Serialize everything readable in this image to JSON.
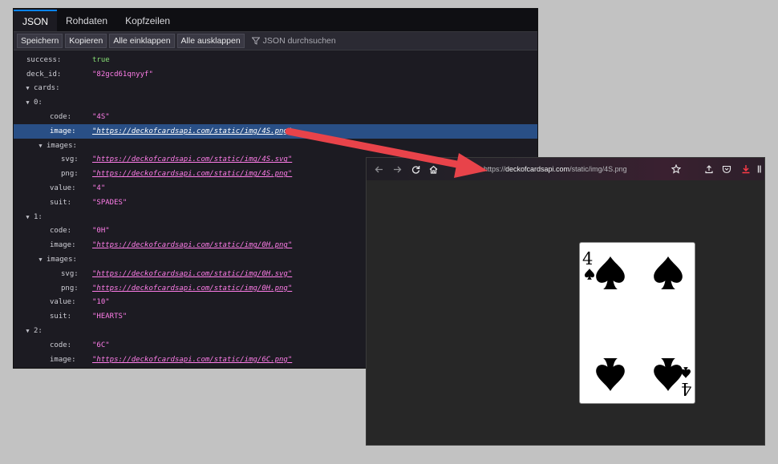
{
  "json_viewer": {
    "tabs": [
      "JSON",
      "Rohdaten",
      "Kopfzeilen"
    ],
    "active_tab": "JSON",
    "toolbar": {
      "save": "Speichern",
      "copy": "Kopieren",
      "collapse_all": "Alle einklappen",
      "expand_all": "Alle ausklappen",
      "filter_placeholder": "JSON durchsuchen"
    },
    "rows": [
      {
        "indent": 0,
        "twisty": "",
        "key": "success:",
        "value": "true",
        "type": "true"
      },
      {
        "indent": 0,
        "twisty": "",
        "key": "deck_id:",
        "value": "\"82gcd61qnyyf\"",
        "type": "str"
      },
      {
        "indent": 0,
        "twisty": "▼",
        "key": "cards:",
        "value": "",
        "type": ""
      },
      {
        "indent": 1,
        "twisty": "▼",
        "key": "0:",
        "value": "",
        "type": ""
      },
      {
        "indent": 3,
        "twisty": "",
        "key": "code:",
        "value": "\"4S\"",
        "type": "str"
      },
      {
        "indent": 3,
        "twisty": "",
        "key": "image:",
        "value": "\"https://deckofcardsapi.com/static/img/4S.png\"",
        "type": "link",
        "selected": true
      },
      {
        "indent": 2,
        "twisty": "▼",
        "key": "images:",
        "value": "",
        "type": ""
      },
      {
        "indent": 4,
        "twisty": "",
        "key": "svg:",
        "value": "\"https://deckofcardsapi.com/static/img/4S.svg\"",
        "type": "link"
      },
      {
        "indent": 4,
        "twisty": "",
        "key": "png:",
        "value": "\"https://deckofcardsapi.com/static/img/4S.png\"",
        "type": "link"
      },
      {
        "indent": 3,
        "twisty": "",
        "key": "value:",
        "value": "\"4\"",
        "type": "str"
      },
      {
        "indent": 3,
        "twisty": "",
        "key": "suit:",
        "value": "\"SPADES\"",
        "type": "str"
      },
      {
        "indent": 1,
        "twisty": "▼",
        "key": "1:",
        "value": "",
        "type": ""
      },
      {
        "indent": 3,
        "twisty": "",
        "key": "code:",
        "value": "\"0H\"",
        "type": "str"
      },
      {
        "indent": 3,
        "twisty": "",
        "key": "image:",
        "value": "\"https://deckofcardsapi.com/static/img/0H.png\"",
        "type": "link"
      },
      {
        "indent": 2,
        "twisty": "▼",
        "key": "images:",
        "value": "",
        "type": ""
      },
      {
        "indent": 4,
        "twisty": "",
        "key": "svg:",
        "value": "\"https://deckofcardsapi.com/static/img/0H.svg\"",
        "type": "link"
      },
      {
        "indent": 4,
        "twisty": "",
        "key": "png:",
        "value": "\"https://deckofcardsapi.com/static/img/0H.png\"",
        "type": "link"
      },
      {
        "indent": 3,
        "twisty": "",
        "key": "value:",
        "value": "\"10\"",
        "type": "str"
      },
      {
        "indent": 3,
        "twisty": "",
        "key": "suit:",
        "value": "\"HEARTS\"",
        "type": "str"
      },
      {
        "indent": 1,
        "twisty": "▼",
        "key": "2:",
        "value": "",
        "type": ""
      },
      {
        "indent": 3,
        "twisty": "",
        "key": "code:",
        "value": "\"6C\"",
        "type": "str"
      },
      {
        "indent": 3,
        "twisty": "",
        "key": "image:",
        "value": "\"https://deckofcardsapi.com/static/img/6C.png\"",
        "type": "link"
      }
    ]
  },
  "browser": {
    "url_prefix": "https://",
    "url_domain": "deckofcardsapi.com",
    "url_path": "/static/img/4S.png",
    "card": {
      "rank": "4",
      "suit": "spades",
      "suit_symbol": "♠"
    }
  },
  "colors": {
    "accent": "#0a84ff",
    "selection": "#294f86",
    "string": "#ff7de9",
    "boolean": "#86de74",
    "arrow": "#e8434a"
  }
}
